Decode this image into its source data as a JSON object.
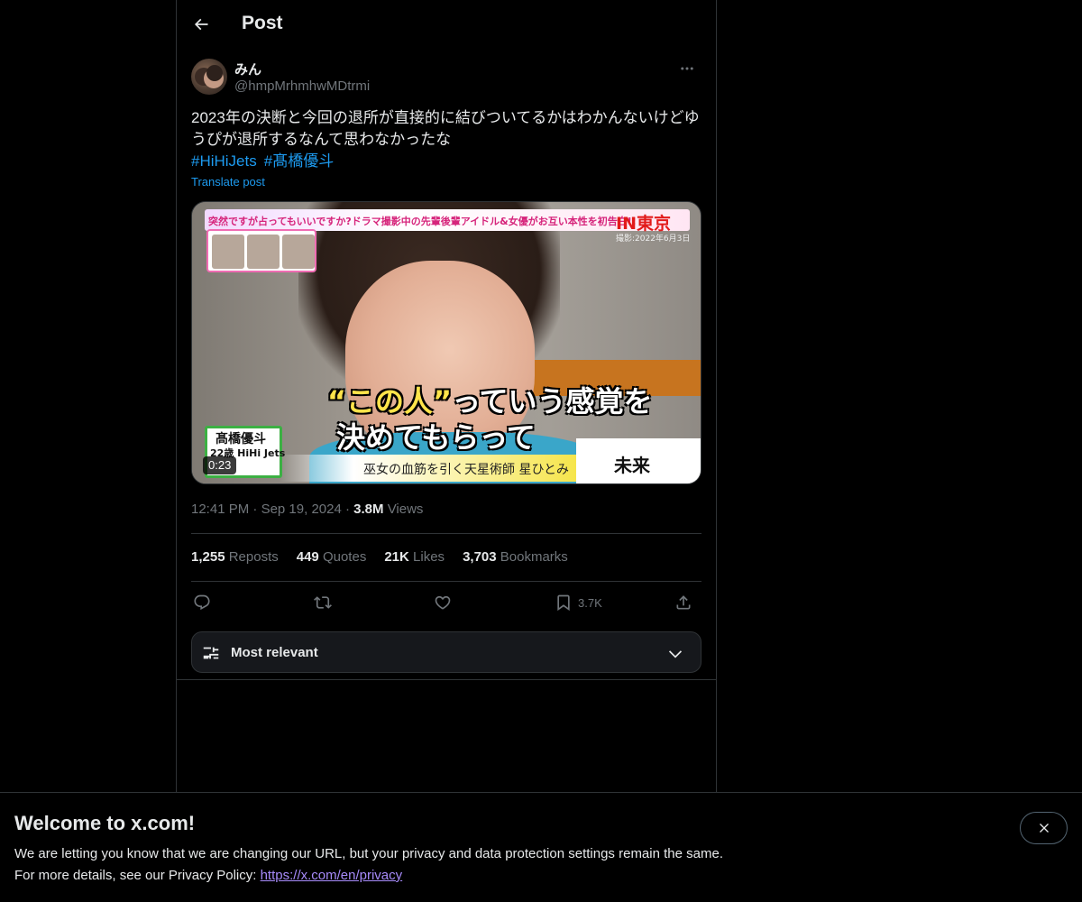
{
  "header": {
    "title": "Post"
  },
  "author": {
    "display_name": "みん",
    "handle": "@hmpMrhmhwMDtrmi"
  },
  "tweet": {
    "text": "2023年の決断と今回の退所が直接的に結びついてるかはわかんないけどゆうぴが退所するなんて思わなかったな",
    "hashtags": [
      "#HiHiJets",
      "#髙橋優斗"
    ],
    "translate_label": "Translate post"
  },
  "media": {
    "duration": "0:23",
    "topbar_text": "突然ですが占ってもいいですか?ドラマ撮影中の先輩後輩アイドル&女優がお互い本性を初告白!!",
    "location_text": "IN東京",
    "date_note": "撮影:2022年6月3日",
    "caption_line1_quote": "“この人”",
    "caption_line1_rest": "っていう感覚を",
    "caption_line2": "決めてもらって",
    "lower_text": "巫女の血筋を引く天星術師 星ひとみ",
    "future_text": "未来",
    "name_card_name": "髙橋優斗",
    "name_card_group": "22歳 HiHi Jets"
  },
  "meta": {
    "time": "12:41 PM",
    "date": "Sep 19, 2024",
    "views_count": "3.8M",
    "views_label": "Views"
  },
  "stats": [
    {
      "count": "1,255",
      "label": "Reposts"
    },
    {
      "count": "449",
      "label": "Quotes"
    },
    {
      "count": "21K",
      "label": "Likes"
    },
    {
      "count": "3,703",
      "label": "Bookmarks"
    }
  ],
  "actions": {
    "bookmark_count": "3.7K"
  },
  "sort": {
    "label": "Most relevant"
  },
  "banner": {
    "title": "Welcome to x.com!",
    "line1": "We are letting you know that we are changing our URL, but your privacy and data protection settings remain the same.",
    "line2_prefix": "For more details, see our Privacy Policy: ",
    "link": "https://x.com/en/privacy"
  },
  "colors": {
    "accent": "#1d9bf0",
    "background": "#000000",
    "text": "#e7e9ea",
    "muted": "#71767b",
    "border": "#2f3336",
    "link_visited": "#a78bfa"
  }
}
